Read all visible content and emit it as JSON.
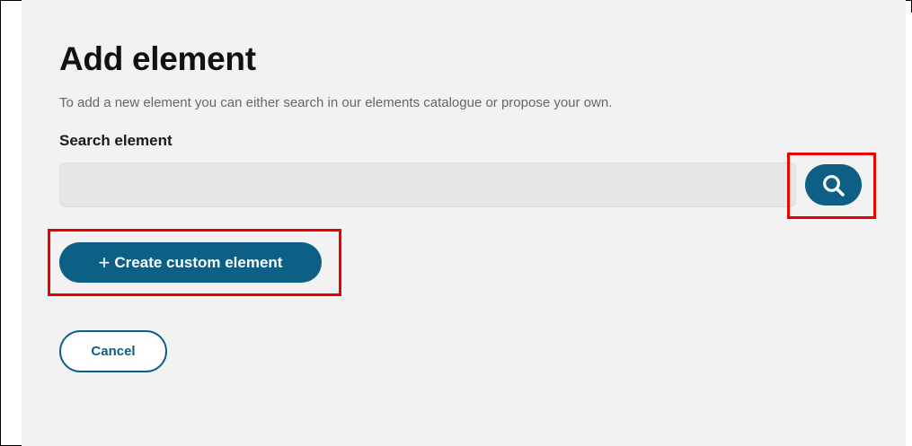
{
  "dialog": {
    "title": "Add element",
    "description": "To add a new element you can either search in our elements catalogue or propose your own."
  },
  "search": {
    "label": "Search element",
    "value": "",
    "placeholder": "",
    "button_icon": "search-icon"
  },
  "create_button": {
    "icon": "+",
    "label": "Create custom element"
  },
  "cancel_button": {
    "label": "Cancel"
  },
  "colors": {
    "primary": "#0d5f86",
    "panel_background": "#f2f2f2",
    "input_background": "#e6e6e6",
    "highlight": "#ee0000"
  }
}
